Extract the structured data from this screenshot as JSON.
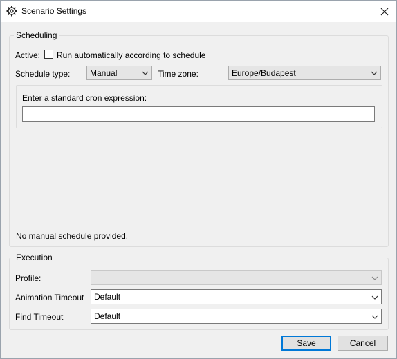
{
  "window": {
    "title": "Scenario Settings",
    "icons": {
      "app": "gear-icon",
      "close": "close-icon"
    }
  },
  "scheduling": {
    "legend": "Scheduling",
    "active_label": "Active:",
    "active_checkbox_label": "Run automatically according to schedule",
    "active_checked": false,
    "schedule_type_label": "Schedule type:",
    "schedule_type_value": "Manual",
    "time_zone_label": "Time zone:",
    "time_zone_value": "Europe/Budapest",
    "cron_prompt": "Enter a standard cron expression:",
    "cron_value": "",
    "status_text": "No manual schedule provided."
  },
  "execution": {
    "legend": "Execution",
    "profile_label": "Profile:",
    "profile_value": "",
    "animation_timeout_label": "Animation Timeout",
    "animation_timeout_value": "Default",
    "find_timeout_label": "Find Timeout",
    "find_timeout_value": "Default"
  },
  "buttons": {
    "save": "Save",
    "cancel": "Cancel"
  },
  "colors": {
    "default_button_border": "#0078d7",
    "window_bg": "#f0f0f0",
    "titlebar_bg": "#ffffff"
  }
}
